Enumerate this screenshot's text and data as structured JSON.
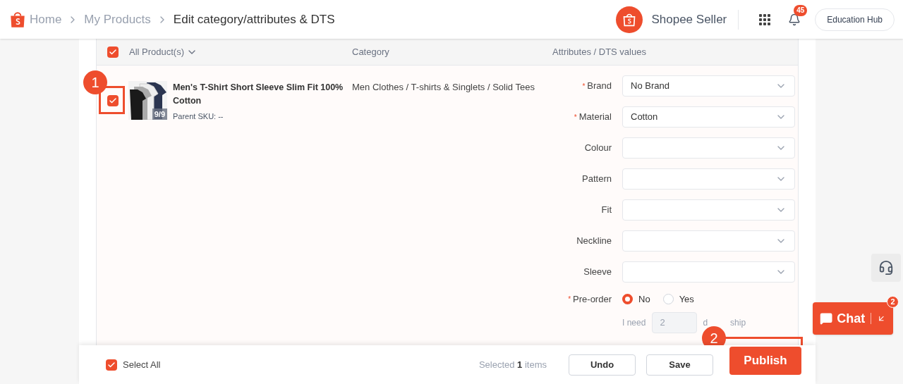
{
  "breadcrumbs": [
    {
      "label": "Home",
      "current": false
    },
    {
      "label": "My Products",
      "current": false
    },
    {
      "label": "Edit category/attributes & DTS",
      "current": true
    }
  ],
  "header": {
    "brand": "Shopee Seller",
    "notifications": "45",
    "education_hub": "Education Hub"
  },
  "table": {
    "select_all_checked": true,
    "columns": [
      "All Product(s)",
      "Category",
      "Attributes / DTS values"
    ],
    "rows": [
      {
        "checked": true,
        "name": "Men's T-Shirt Short Sleeve Slim Fit 100% Cotton",
        "image_count": "9/9",
        "parent_sku": "Parent SKU: --",
        "category": "Men Clothes / T-shirts & Singlets / Solid Tees",
        "attributes": [
          {
            "label": "Brand",
            "required_mark": "*",
            "value": "No Brand"
          },
          {
            "label": "Material",
            "required_mark": "*",
            "value": "Cotton"
          },
          {
            "label": "Colour"
          },
          {
            "label": "Pattern"
          },
          {
            "label": "Fit"
          },
          {
            "label": "Neckline"
          },
          {
            "label": "Sleeve"
          }
        ],
        "preorder": {
          "label": "Pre-order",
          "required_mark": "*",
          "options": [
            {
              "label": "No",
              "selected": true
            },
            {
              "label": "Yes",
              "selected": false
            }
          ],
          "need_label": "I need",
          "days": "2",
          "suffix_start": "d",
          "suffix_end": "ship"
        }
      }
    ]
  },
  "footer": {
    "select_all": {
      "label": "Select All",
      "checked": true
    },
    "selected_text": "Selected **1** items",
    "buttons": [
      {
        "label": "Undo",
        "kind": "secondary"
      },
      {
        "label": "Save",
        "kind": "secondary"
      },
      {
        "label": "Publish",
        "kind": "primary"
      }
    ]
  },
  "annotations": [
    "1",
    "2"
  ],
  "chat": {
    "label": "Chat",
    "badge": "2"
  }
}
